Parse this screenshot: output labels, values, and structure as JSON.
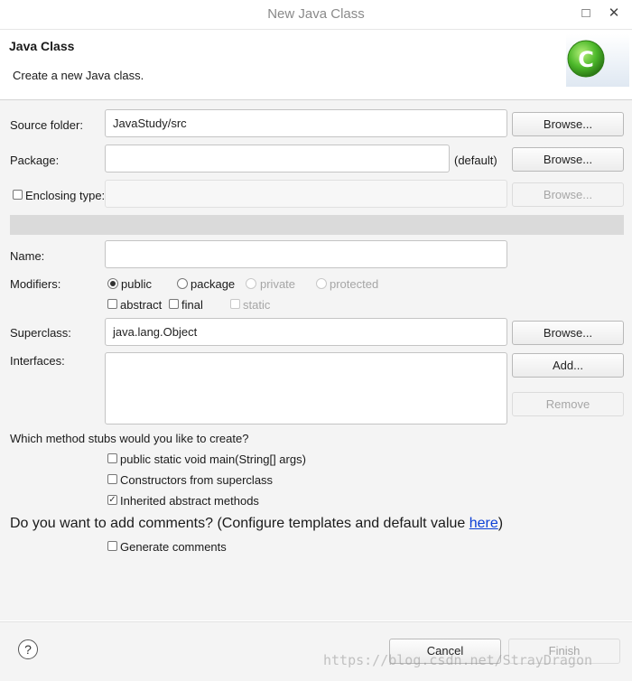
{
  "window": {
    "title": "New Java Class",
    "maximize_icon": "maximize-icon",
    "close_icon": "close-icon"
  },
  "header": {
    "title": "Java Class",
    "description": "Create a new Java class.",
    "logo_letter": "C"
  },
  "form": {
    "source_folder": {
      "label": "Source folder:",
      "value": "JavaStudy/src",
      "browse": "Browse..."
    },
    "package": {
      "label": "Package:",
      "value": "",
      "default_hint": "(default)",
      "browse": "Browse..."
    },
    "enclosing": {
      "label": "Enclosing type:",
      "value": "",
      "checked": false,
      "browse": "Browse..."
    },
    "name": {
      "label": "Name:",
      "value": ""
    },
    "modifiers": {
      "label": "Modifiers:",
      "radios": [
        {
          "label": "public",
          "selected": true,
          "enabled": true
        },
        {
          "label": "package",
          "selected": false,
          "enabled": true
        },
        {
          "label": "private",
          "selected": false,
          "enabled": false
        },
        {
          "label": "protected",
          "selected": false,
          "enabled": false
        }
      ],
      "checks": [
        {
          "label": "abstract",
          "checked": false,
          "enabled": true
        },
        {
          "label": "final",
          "checked": false,
          "enabled": true
        },
        {
          "label": "static",
          "checked": false,
          "enabled": false
        }
      ]
    },
    "superclass": {
      "label": "Superclass:",
      "value": "java.lang.Object",
      "browse": "Browse..."
    },
    "interfaces": {
      "label": "Interfaces:",
      "add": "Add...",
      "remove": "Remove"
    },
    "stubs": {
      "question": "Which method stubs would you like to create?",
      "options": [
        {
          "label": "public static void main(String[] args)",
          "checked": false
        },
        {
          "label": "Constructors from superclass",
          "checked": false
        },
        {
          "label": "Inherited abstract methods",
          "checked": true
        }
      ]
    },
    "comments": {
      "question_prefix": "Do you want to add comments? (Configure templates and default value ",
      "link": "here",
      "question_suffix": ")",
      "option": {
        "label": "Generate comments",
        "checked": false
      }
    }
  },
  "footer": {
    "help": "?",
    "cancel": "Cancel",
    "finish": "Finish"
  },
  "watermark": "https://blog.csdn.net/StrayDragon",
  "colors": {
    "link": "#0b3fd6",
    "logo_green": "#4cb82a"
  }
}
